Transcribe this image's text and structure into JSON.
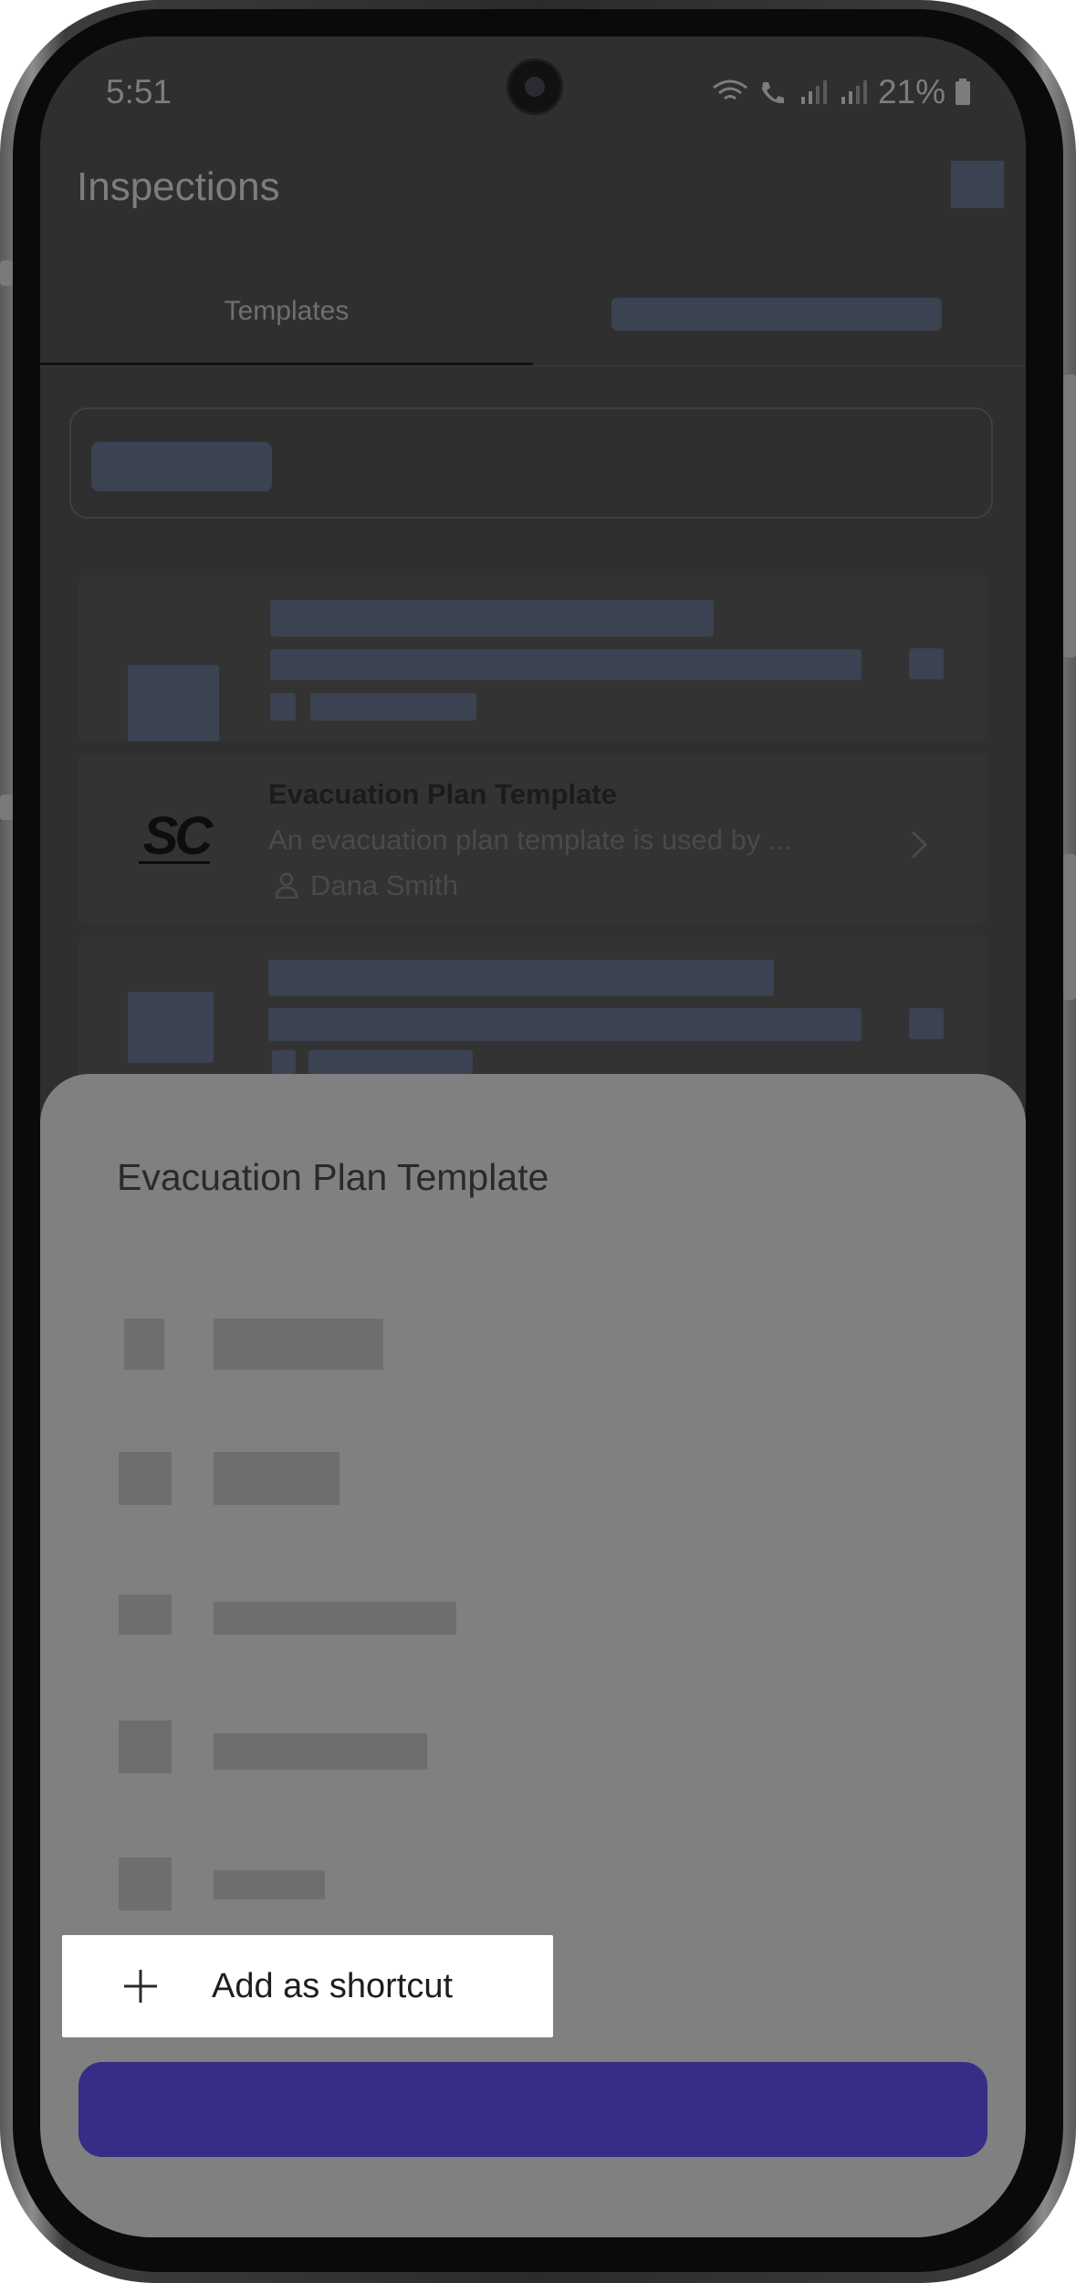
{
  "status_bar": {
    "time": "5:51",
    "battery": "21%"
  },
  "app": {
    "title": "Inspections"
  },
  "tabs": [
    {
      "label": "Templates"
    }
  ],
  "template_card": {
    "title": "Evacuation Plan Template",
    "description": "An evacuation plan template is used by ...",
    "author": "Dana Smith",
    "logo_text": "SC"
  },
  "sheet": {
    "title": "Evacuation Plan Template"
  },
  "shortcut_popup": {
    "label": "Add as shortcut"
  },
  "colors": {
    "primary_button": "#352d86",
    "skeleton": "#3b4251",
    "sheet": "#808080"
  }
}
